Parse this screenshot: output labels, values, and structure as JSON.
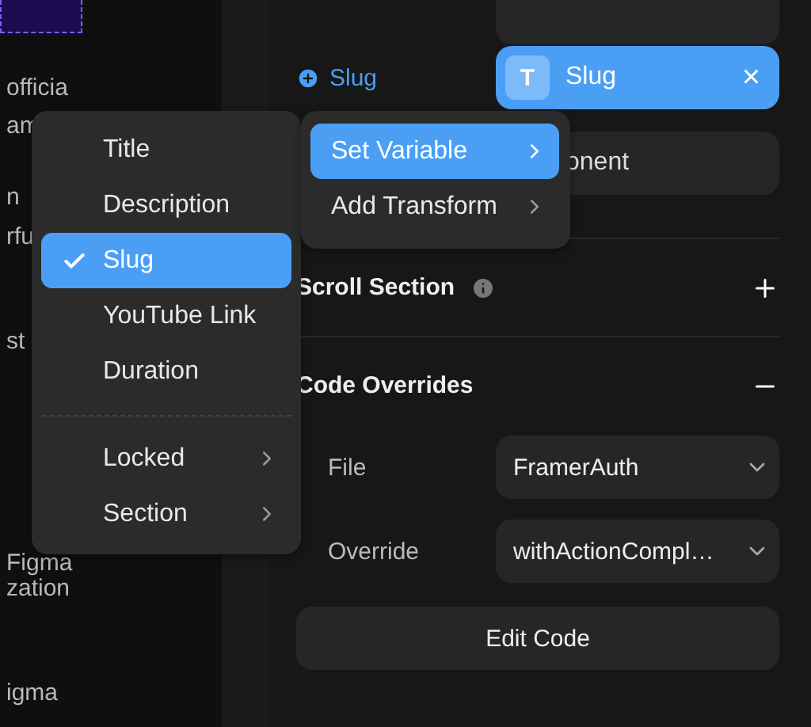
{
  "canvas": {
    "lines": [
      "officia",
      "am",
      "n",
      "rfu",
      "st",
      "Figma",
      "zation",
      "igma"
    ]
  },
  "panel": {
    "slug_row": {
      "label": "Slug",
      "token_letter": "T",
      "value": "Slug",
      "clear": "×"
    },
    "component_field": {
      "value": "onent"
    },
    "sections": [
      {
        "title": "Scroll Section",
        "info": true,
        "expanded": false
      },
      {
        "title": "Code Overrides",
        "expanded": true,
        "fields": [
          {
            "label": "File",
            "value": "FramerAuth"
          },
          {
            "label": "Override",
            "value": "withActionCompl…"
          }
        ],
        "button": "Edit Code"
      }
    ]
  },
  "field_menu": {
    "items": [
      {
        "kind": "field",
        "label": "Title",
        "selected": false
      },
      {
        "kind": "field",
        "label": "Description",
        "selected": false
      },
      {
        "kind": "field",
        "label": "Slug",
        "selected": true
      },
      {
        "kind": "field",
        "label": "YouTube Link",
        "selected": false
      },
      {
        "kind": "field",
        "label": "Duration",
        "selected": false
      },
      {
        "kind": "submenu",
        "label": "Locked",
        "selected": false
      },
      {
        "kind": "submenu",
        "label": "Section",
        "selected": false
      }
    ]
  },
  "action_menu": {
    "items": [
      {
        "label": "Set Variable",
        "selected": true
      },
      {
        "label": "Add Transform",
        "selected": false
      }
    ]
  }
}
